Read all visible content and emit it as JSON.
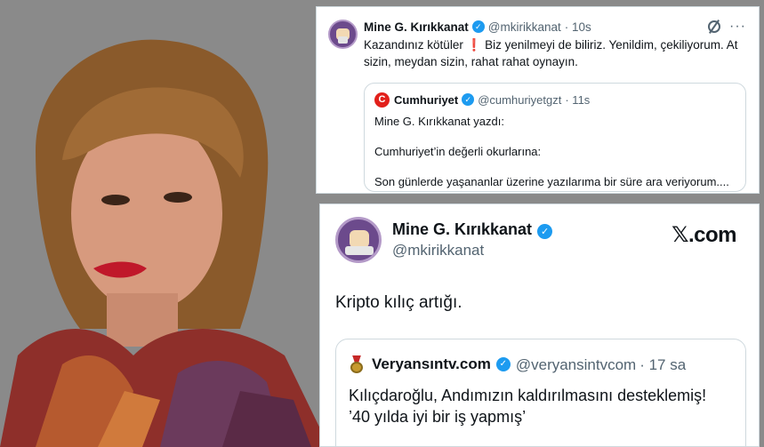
{
  "tweet1": {
    "author_name": "Mine G. Kırıkkanat",
    "verified_mark": "✓",
    "handle": "@mkirikkanat",
    "time": "· 10s",
    "more_label": "···",
    "text_before": "Kazandınız kötüler",
    "exclamation": "❗",
    "text_after": " Biz yenilmeyi de biliriz. Yenildim, çekiliyorum. At sizin, meydan sizin, rahat rahat  oynayın.",
    "quote": {
      "logo_letter": "C",
      "author_name": "Cumhuriyet",
      "handle": "@cumhuriyetgzt",
      "time": "· 11s",
      "line1": "Mine G. Kırıkkanat yazdı:",
      "line2": "Cumhuriyet’in değerli okurlarına:",
      "line3": "Son günlerde yaşananlar üzerine yazılarıma bir süre ara veriyorum...."
    }
  },
  "tweet2": {
    "author_name": "Mine G. Kırıkkanat",
    "verified_mark": "✓",
    "handle": "@mkirikkanat",
    "site_label": "𝕏.com",
    "text": "Kripto kılıç artığı.",
    "quote": {
      "author_name": "Veryansıntv.com",
      "handle": "@veryansintvcom",
      "time": "· 17 sa",
      "line1": "Kılıçdaroğlu, Andımızın kaldırılmasını desteklemiş!",
      "line2": "’40 yılda iyi bir iş yapmış’"
    }
  },
  "colors": {
    "background": "#8a8a8a",
    "verified": "#1d9bf0",
    "cumhuriyet": "#e2201b",
    "handle": "#536471"
  }
}
